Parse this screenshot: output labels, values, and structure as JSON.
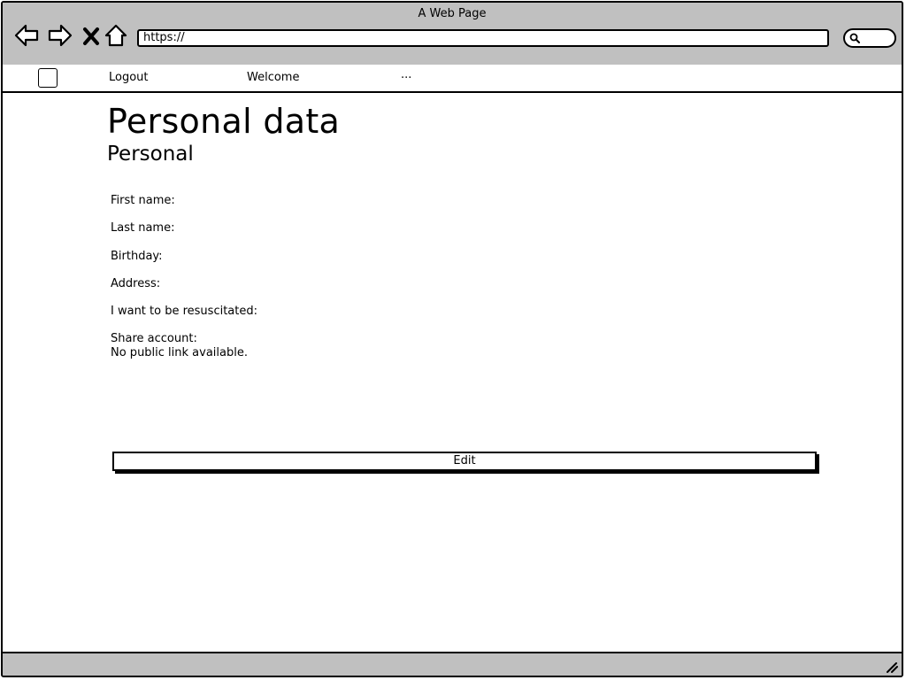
{
  "browser": {
    "window_title": "A Web Page",
    "url": "https://",
    "icons": {
      "back": "back-arrow-icon",
      "forward": "forward-arrow-icon",
      "stop": "close-icon",
      "home": "home-icon",
      "search": "search-icon",
      "resize": "resize-grip-icon"
    }
  },
  "menu": {
    "items": [
      {
        "label": "Logout"
      },
      {
        "label": "Welcome"
      },
      {
        "label": "..."
      }
    ]
  },
  "page": {
    "title": "Personal data",
    "section_title": "Personal",
    "fields": {
      "first_name": "First name:",
      "last_name": "Last name:",
      "birthday": "Birthday:",
      "address": "Address:",
      "resuscitate": "I want to be resuscitated:",
      "share_account": "Share account:",
      "share_status": "No public link available."
    },
    "edit_label": "Edit"
  },
  "colors": {
    "chrome": "#c0c0c0",
    "background": "#ffffff",
    "stroke": "#000000"
  }
}
